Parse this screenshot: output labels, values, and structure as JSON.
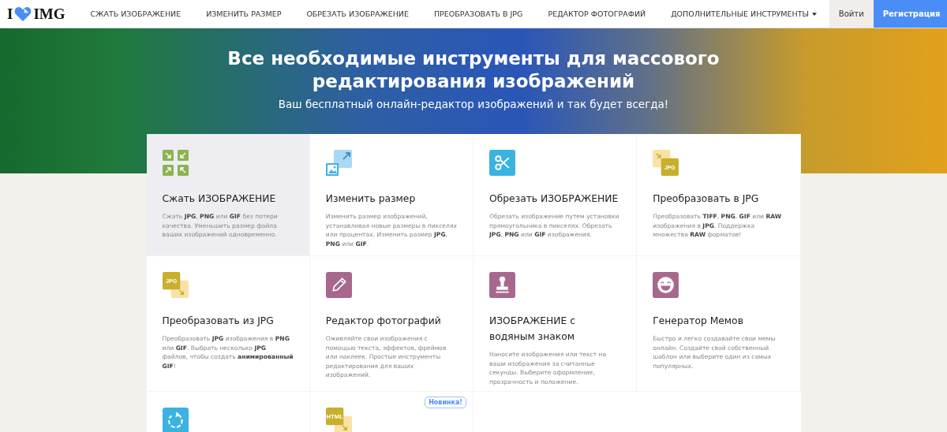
{
  "header": {
    "logo": {
      "left": "I",
      "right": "IMG"
    },
    "nav": [
      {
        "label": "СЖАТЬ ИЗОБРАЖЕНИЕ",
        "dropdown": false
      },
      {
        "label": "ИЗМЕНИТЬ РАЗМЕР",
        "dropdown": false
      },
      {
        "label": "ОБРЕЗАТЬ ИЗОБРАЖЕНИЕ",
        "dropdown": false
      },
      {
        "label": "ПРЕОБРАЗОВАТЬ В JPG",
        "dropdown": false
      },
      {
        "label": "РЕДАКТОР ФОТОГРАФИЙ",
        "dropdown": false
      },
      {
        "label": "ДОПОЛНИТЕЛЬНЫЕ ИНСТРУМЕНТЫ",
        "dropdown": true
      }
    ],
    "login": "Войти",
    "signup": "Регистрация"
  },
  "hero": {
    "title": "Все необходимые инструменты для массового редактирования изображений",
    "subtitle": "Ваш бесплатный онлайн-редактор изображений и так будет всегда!"
  },
  "tools": [
    {
      "kind": "compress",
      "title": "Сжать ИЗОБРАЖЕНИЕ",
      "description": "Сжать **JPG**, **PNG** или **GIF** без потери качества. Уменьшить размер файла ваших изображений одновременно.",
      "hovered": true
    },
    {
      "kind": "resize",
      "title": "Изменить размер",
      "description": "Изменить размер изображений, устанавливая новые размеры в пикселях или процентах. Изменить размер **JPG**, **PNG** или **GIF**.",
      "hovered": false
    },
    {
      "kind": "crop",
      "title": "Обрезать ИЗОБРАЖЕНИЕ",
      "description": "Обрезать изображение путем установки прямоугольника в пикселях. Обрезать **JPG**, **PNG** или **GIF** изображения.",
      "hovered": false
    },
    {
      "kind": "tojpg",
      "title": "Преобразовать в JPG",
      "description": "Преобразовать **TIFF**, **PNG**, **GIF** или **RAW** изображения в **JPG**. Поддержка множества **RAW** форматов!",
      "hovered": false
    },
    {
      "kind": "fromjpg",
      "title": "Преобразовать из JPG",
      "description": "Преобразовать **JPG** изображения в **PNG** или **GIF**. Выбрать несколько **JPG** файлов, чтобы создать **анимированный GIF**!",
      "hovered": false
    },
    {
      "kind": "editor",
      "title": "Редактор фотографий",
      "description": "Оживляйте свои изображения с помощью текста, эффектов, фреймов или наклеек. Простые инструменты редактирования для ваших изображений.",
      "hovered": false
    },
    {
      "kind": "watermark",
      "title": "ИЗОБРАЖЕНИЕ с водяным знаком",
      "description": "Наносите изображения или текст на ваши изображения за считанные секунды. Выберите оформление, прозрачность и положение.",
      "hovered": false
    },
    {
      "kind": "meme",
      "title": "Генератор Мемов",
      "description": "Быстро и легко создавайте свои мемы онлайн. Создайте свой собственный шаблон или выберите один из самых популярных.",
      "hovered": false
    },
    {
      "kind": "rotate",
      "hovered": false
    },
    {
      "kind": "html",
      "badge": "Новинка!",
      "icon_text": "HTML",
      "hovered": false
    }
  ],
  "icon_texts": {
    "tojpg": "JPG",
    "fromjpg": "JPG"
  }
}
